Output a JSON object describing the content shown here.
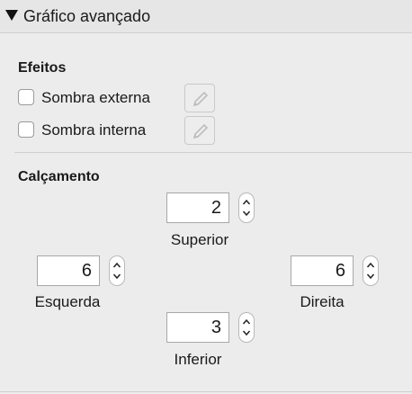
{
  "panel": {
    "title": "Gráfico avançado",
    "collapse_icon": "triangle-down-icon"
  },
  "effects": {
    "title": "Efeitos",
    "items": [
      {
        "label": "Sombra externa",
        "checked": false,
        "edit_icon": "pencil-icon"
      },
      {
        "label": "Sombra interna",
        "checked": false,
        "edit_icon": "pencil-icon"
      }
    ]
  },
  "padding": {
    "title": "Calçamento",
    "top": {
      "value": "2",
      "label": "Superior"
    },
    "left": {
      "value": "6",
      "label": "Esquerda"
    },
    "right": {
      "value": "6",
      "label": "Direita"
    },
    "bottom": {
      "value": "3",
      "label": "Inferior"
    }
  }
}
